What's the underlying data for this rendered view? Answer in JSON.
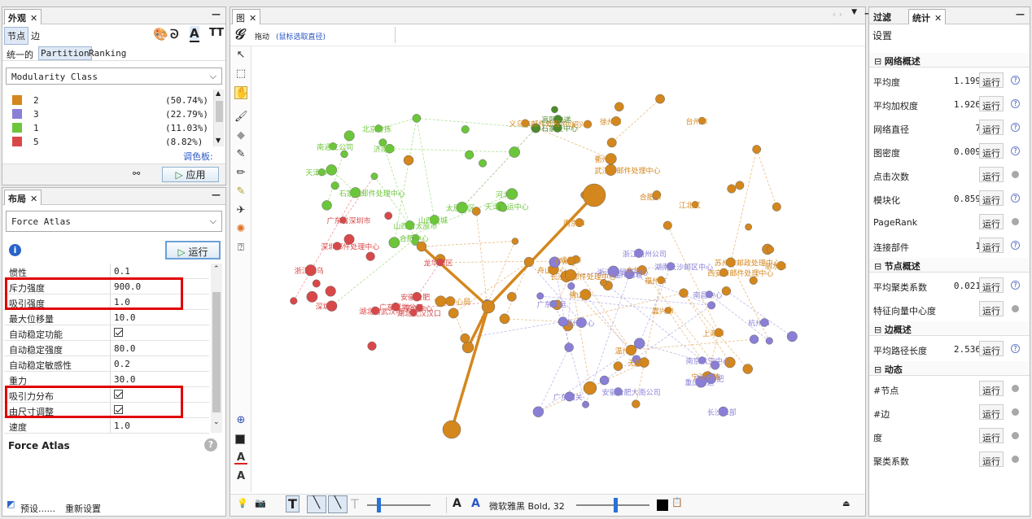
{
  "appearance": {
    "tab": "外观",
    "node_tab": "节点",
    "edge_tab": "边",
    "unique": "统一的",
    "partition": "Partition",
    "ranking": "Ranking",
    "attribute": "Modularity Class",
    "classes": [
      {
        "id": "2",
        "pct": "(50.74%)",
        "color": "#d4871d"
      },
      {
        "id": "3",
        "pct": "(22.79%)",
        "color": "#8a7fd6"
      },
      {
        "id": "1",
        "pct": "(11.03%)",
        "color": "#6cc63a"
      },
      {
        "id": "5",
        "pct": "(8.82%)",
        "color": "#d94848"
      }
    ],
    "palette": "调色板:",
    "apply": "应用"
  },
  "layout": {
    "tab": "布局",
    "algorithm": "Force Atlas",
    "run": "运行",
    "props": [
      {
        "k": "惯性",
        "v": "0.1"
      },
      {
        "k": "斥力强度",
        "v": "900.0"
      },
      {
        "k": "吸引强度",
        "v": "1.0"
      },
      {
        "k": "最大位移量",
        "v": "10.0"
      },
      {
        "k": "自动稳定功能",
        "v": "check"
      },
      {
        "k": "自动稳定强度",
        "v": "80.0"
      },
      {
        "k": "自动稳定敏感性",
        "v": "0.2"
      },
      {
        "k": "重力",
        "v": "30.0"
      },
      {
        "k": "吸引力分布",
        "v": "check"
      },
      {
        "k": "由尺寸调整",
        "v": "check"
      },
      {
        "k": "速度",
        "v": "1.0"
      }
    ],
    "desc_title": "Force Atlas",
    "preset": "预设......",
    "reset": "重新设置"
  },
  "graph": {
    "tab": "图",
    "mode": "拖动",
    "hint": "(鼠标选取直径)",
    "font": "微软雅黑 Bold, 32",
    "font_a1": "A",
    "font_a2": "A"
  },
  "right": {
    "tab_filter": "过滤",
    "tab_stats": "统计",
    "settings": "设置",
    "run": "运行",
    "sections": [
      {
        "title": "网络概述",
        "items": [
          {
            "k": "平均度",
            "v": "1.199",
            "help": true
          },
          {
            "k": "平均加权度",
            "v": "1.926",
            "help": true
          },
          {
            "k": "网络直径",
            "v": "7",
            "help": true
          },
          {
            "k": "图密度",
            "v": "0.009",
            "help": true
          },
          {
            "k": "点击次数",
            "v": "",
            "help": false
          },
          {
            "k": "模块化",
            "v": "0.859",
            "help": true
          },
          {
            "k": "PageRank",
            "v": "",
            "help": false
          },
          {
            "k": "连接部件",
            "v": "1",
            "help": true
          }
        ]
      },
      {
        "title": "节点概述",
        "items": [
          {
            "k": "平均聚类系数",
            "v": "0.021",
            "help": true
          },
          {
            "k": "特征向量中心度",
            "v": "",
            "help": false
          }
        ]
      },
      {
        "title": "边概述",
        "items": [
          {
            "k": "平均路径长度",
            "v": "2.536",
            "help": true
          }
        ]
      },
      {
        "title": "动态",
        "items": [
          {
            "k": "#节点",
            "v": "",
            "help": false
          },
          {
            "k": "#边",
            "v": "",
            "help": false
          },
          {
            "k": "度",
            "v": "",
            "help": false
          },
          {
            "k": "聚类系数",
            "v": "",
            "help": false
          }
        ]
      }
    ]
  },
  "colors": {
    "orange": "#d4871d",
    "purple": "#8a7fd6",
    "green": "#6cc63a",
    "red": "#d94848",
    "darkgreen": "#4e8a2a"
  },
  "labels": {
    "orange": [
      "徐州市",
      "西安市邮件处理中心",
      "无锡市",
      "武汉市邮件处理中心",
      "苏州市邮政处理中心",
      "长沙市邮件处理中心",
      "宁波中心局",
      "舟山中心",
      "江北区",
      "宁波分拣",
      "义乌市邮件处理中心",
      "合肥市",
      "金华",
      "台州市",
      "成都市",
      "广州市",
      "温州市",
      "嘉兴市",
      "南京市",
      "上海市",
      "丽水市",
      "衢州市",
      "绍兴",
      "佛山市",
      "福州市"
    ],
    "purple": [
      "南京航空中心",
      "浙江自贸区中心",
      "安徽合肥大南公司",
      "长沙二部",
      "湖南长沙邮区中心",
      "泉州中心",
      "杭州市",
      "广东韶关",
      "安徽合肥",
      "温州鹿城",
      "广东陆运",
      "重庆转运",
      "浙江衢州公司",
      "南昌中心"
    ],
    "green": [
      "天津市",
      "山西省太原市",
      "天津转运中心",
      "石家庄邮件处理中心",
      "济南市",
      "合肥中心",
      "南通三公司",
      "河北省",
      "太原邮区",
      "山西晋城",
      "北京分拣"
    ],
    "red": [
      "深圳邮件处理中心",
      "龙华邮区",
      "广东省深圳市",
      "湖北省武汉市",
      "安徽合肥",
      "浙江义乌",
      "深圳中心",
      "广东深圳公司",
      "湖北武汉汉口",
      "深圳市"
    ],
    "darkgreen": [
      "高阳快递",
      "石家庄中心"
    ]
  }
}
